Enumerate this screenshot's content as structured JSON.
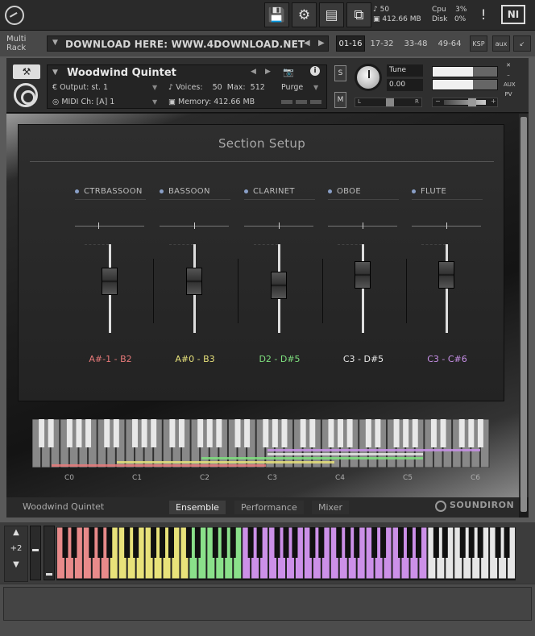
{
  "toolbar": {
    "voices_count": "50",
    "memory": "412.66 MB",
    "cpu_label": "Cpu",
    "cpu_value": "3%",
    "disk_label": "Disk",
    "disk_value": "0%",
    "alert": "!",
    "ni_logo": "NI"
  },
  "rack": {
    "label_line1": "Multi",
    "label_line2": "Rack",
    "preset_name": "DOWNLOAD HERE: WWW.4DOWNLOAD.NET",
    "pages": [
      "01-16",
      "17-32",
      "33-48",
      "49-64"
    ],
    "ksp": "KSP",
    "aux": "aux"
  },
  "instrument": {
    "title": "Woodwind Quintet",
    "output_label": "Output:",
    "output_value": "st. 1",
    "voices_label": "Voices:",
    "voices_value": "50",
    "max_label": "Max:",
    "max_value": "512",
    "purge": "Purge",
    "midi_label": "MIDI Ch:",
    "midi_value": "[A]  1",
    "memory_label": "Memory:",
    "memory_value": "412.66 MB",
    "solo": "S",
    "mute": "M",
    "tune_label": "Tune",
    "tune_value": "0.00",
    "pan_l": "L",
    "pan_r": "R",
    "vol_minus": "−",
    "vol_plus": "+",
    "aux": "AUX",
    "pv": "PV"
  },
  "section": {
    "title": "Section Setup",
    "instruments": [
      {
        "name": "CTRBASSOON",
        "range": "A#-1 - B2",
        "color": "#e87a7a",
        "fader": 0.62
      },
      {
        "name": "BASSOON",
        "range": "A#0 - B3",
        "color": "#e6e07a",
        "fader": 0.62
      },
      {
        "name": "CLARINET",
        "range": "D2 - D#5",
        "color": "#7ee07e",
        "fader": 0.55
      },
      {
        "name": "OBOE",
        "range": "C3 - D#5",
        "color": "#e8e8e8",
        "fader": 0.72
      },
      {
        "name": "FLUTE",
        "range": "C3 - C#6",
        "color": "#c890e8",
        "fader": 0.72
      }
    ]
  },
  "keyboard_labels": [
    "C0",
    "C1",
    "C2",
    "C3",
    "C4",
    "C5",
    "C6"
  ],
  "footer": {
    "instrument_name": "Woodwind Quintet",
    "tabs": [
      "Ensemble",
      "Performance",
      "Mixer"
    ],
    "brand": "SOUNDIRON"
  },
  "bottom_keyboard": {
    "octave_value": "+2",
    "colors": {
      "red": "#e88a8a",
      "yellow": "#e8e27a",
      "green": "#8ae08a",
      "purple": "#cc90e8"
    }
  }
}
